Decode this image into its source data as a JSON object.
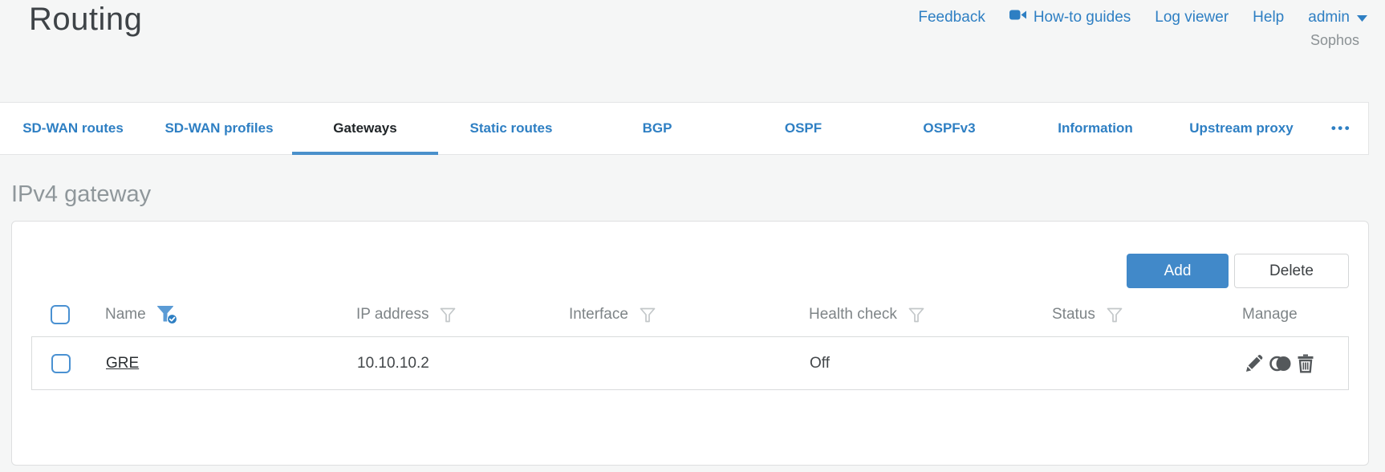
{
  "page": {
    "title": "Routing",
    "brand": "Sophos"
  },
  "header_links": {
    "feedback": "Feedback",
    "howto": "How-to guides",
    "log_viewer": "Log viewer",
    "help": "Help",
    "user": "admin"
  },
  "tabs": {
    "items": [
      {
        "label": "SD-WAN routes"
      },
      {
        "label": "SD-WAN profiles"
      },
      {
        "label": "Gateways"
      },
      {
        "label": "Static routes"
      },
      {
        "label": "BGP"
      },
      {
        "label": "OSPF"
      },
      {
        "label": "OSPFv3"
      },
      {
        "label": "Information"
      },
      {
        "label": "Upstream proxy"
      }
    ],
    "active": "Gateways",
    "overflow": "•••"
  },
  "section": {
    "heading": "IPv4 gateway"
  },
  "toolbar": {
    "add": "Add",
    "delete": "Delete"
  },
  "table": {
    "columns": [
      {
        "label": "Name",
        "filter": "active"
      },
      {
        "label": "IP address",
        "filter": "default"
      },
      {
        "label": "Interface",
        "filter": "default"
      },
      {
        "label": "Health check",
        "filter": "default"
      },
      {
        "label": "Status",
        "filter": "default"
      },
      {
        "label": "Manage",
        "filter": "none"
      }
    ],
    "rows": [
      {
        "name": "GRE",
        "ip_address": "10.10.10.2",
        "interface": "",
        "health_check": "Off",
        "status": "green",
        "actions": [
          "edit",
          "clone",
          "delete"
        ]
      }
    ]
  },
  "colors": {
    "link_blue": "#2e7fc3",
    "active_tab_underline": "#4a90cb",
    "add_button": "#4189c9",
    "status_green": "#8dc63f"
  }
}
